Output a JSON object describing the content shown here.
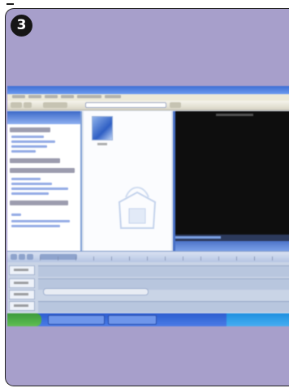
{
  "step": {
    "number": "3"
  },
  "screenshot": {
    "app_title": "",
    "preview_caption": "",
    "colors": {
      "card_background": "#a79fcb",
      "titlebar": "#3f6fd3",
      "preview_background": "#0e0e0e",
      "taskbar": "#2d5dd0"
    }
  }
}
